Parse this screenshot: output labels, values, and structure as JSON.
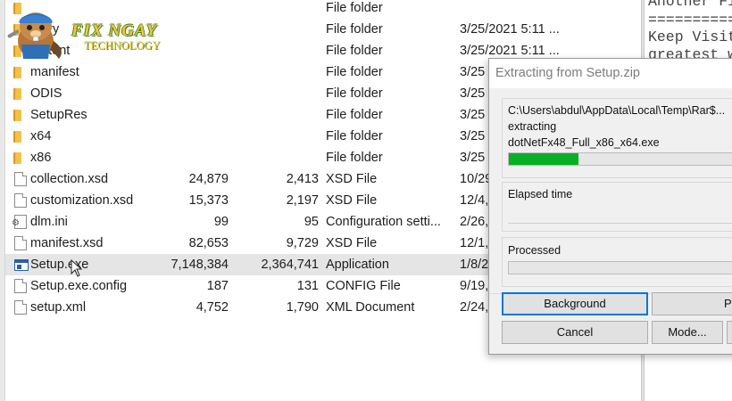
{
  "files": [
    {
      "name": "",
      "size": "",
      "packed": "",
      "type": "File folder",
      "modified": "",
      "icon": "folder-icon"
    },
    {
      "name": "...ary",
      "size": "",
      "packed": "",
      "type": "File folder",
      "modified": "3/25/2021 5:11 ...",
      "icon": "folder-icon"
    },
    {
      "name": "...atent",
      "size": "",
      "packed": "",
      "type": "File folder",
      "modified": "3/25/2021 5:11 ...",
      "icon": "folder-icon"
    },
    {
      "name": "manifest",
      "size": "",
      "packed": "",
      "type": "File folder",
      "modified": "3/25",
      "icon": "folder-icon"
    },
    {
      "name": "ODIS",
      "size": "",
      "packed": "",
      "type": "File folder",
      "modified": "3/25",
      "icon": "folder-icon"
    },
    {
      "name": "SetupRes",
      "size": "",
      "packed": "",
      "type": "File folder",
      "modified": "3/25",
      "icon": "folder-icon"
    },
    {
      "name": "x64",
      "size": "",
      "packed": "",
      "type": "File folder",
      "modified": "3/25",
      "icon": "folder-icon"
    },
    {
      "name": "x86",
      "size": "",
      "packed": "",
      "type": "File folder",
      "modified": "3/25",
      "icon": "folder-icon"
    },
    {
      "name": "collection.xsd",
      "size": "24,879",
      "packed": "2,413",
      "type": "XSD File",
      "modified": "10/29",
      "icon": "document-icon"
    },
    {
      "name": "customization.xsd",
      "size": "15,373",
      "packed": "2,197",
      "type": "XSD File",
      "modified": "12/4,",
      "icon": "document-icon"
    },
    {
      "name": "dlm.ini",
      "size": "99",
      "packed": "95",
      "type": "Configuration setti...",
      "modified": "2/26,",
      "icon": "settings-file-icon"
    },
    {
      "name": "manifest.xsd",
      "size": "82,653",
      "packed": "9,729",
      "type": "XSD File",
      "modified": "12/1,",
      "icon": "document-icon"
    },
    {
      "name": "Setup.exe",
      "size": "7,148,384",
      "packed": "2,364,741",
      "type": "Application",
      "modified": "1/8/2",
      "icon": "application-icon"
    },
    {
      "name": "Setup.exe.config",
      "size": "187",
      "packed": "131",
      "type": "CONFIG File",
      "modified": "9/19,",
      "icon": "document-icon"
    },
    {
      "name": "setup.xml",
      "size": "4,752",
      "packed": "1,790",
      "type": "XML Document",
      "modified": "2/24,",
      "icon": "document-icon"
    }
  ],
  "selected_row": 12,
  "logo": {
    "title": "FIX NGAY",
    "subtitle": "TECHNOLOGY"
  },
  "text_panel": {
    "lines": [
      "Another Fi",
      "==========",
      "Keep Visit",
      "greatest w"
    ]
  },
  "dialog": {
    "title": "Extracting from Setup.zip",
    "path": "C:\\Users\\abdul\\AppData\\Local\\Temp\\Rar$...",
    "action": "extracting",
    "current_file": "dotNetFx48_Full_x86_x64.exe",
    "file_progress": 0.29,
    "elapsed_label": "Elapsed time",
    "processed_label": "Processed",
    "processed_progress": 0,
    "buttons": {
      "background": "Background",
      "pause": "Pause",
      "cancel": "Cancel",
      "mode": "Mode..."
    }
  },
  "colors": {
    "progress_fill": "#06b025",
    "default_button_border": "#0078d7",
    "folder": "#f3c04a",
    "logo_text": "#f6c431"
  }
}
